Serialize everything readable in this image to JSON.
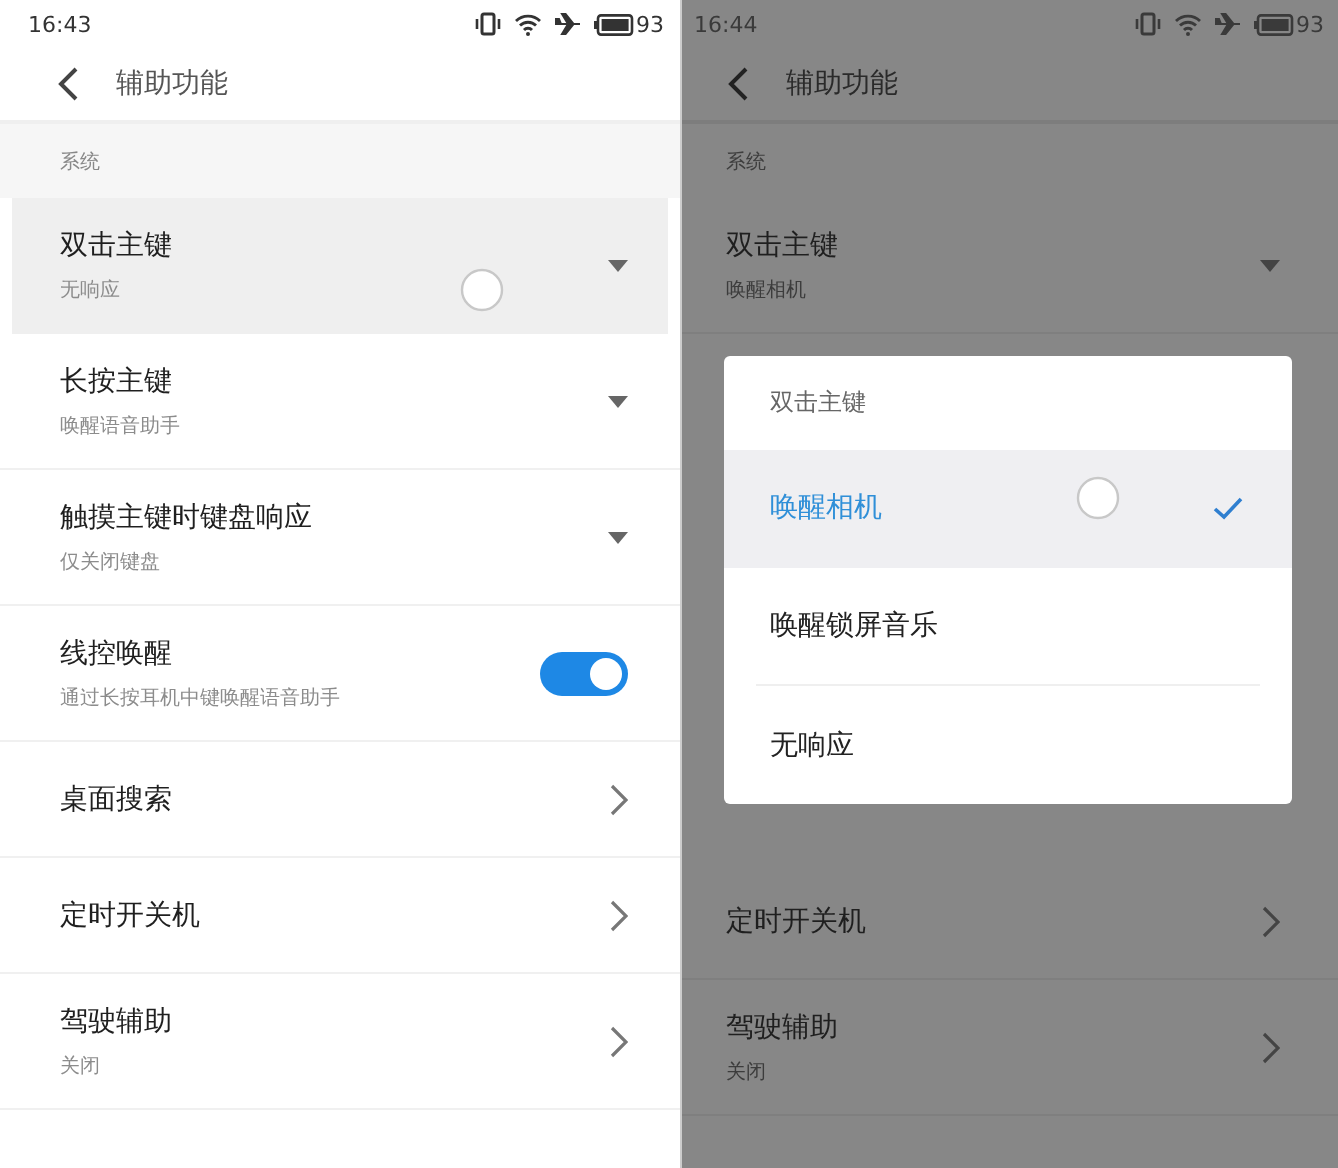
{
  "screens": [
    {
      "dimmed": false,
      "status_bar": {
        "time": "16:43",
        "battery": "93"
      },
      "header": {
        "title": "辅助功能"
      },
      "section": "系统",
      "rows": [
        {
          "kind": "dropdown",
          "title": "双击主键",
          "subtitle": "无响应",
          "pressed": true,
          "touched": true
        },
        {
          "kind": "dropdown",
          "title": "长按主键",
          "subtitle": "唤醒语音助手",
          "pressed": false,
          "touched": false
        },
        {
          "kind": "dropdown",
          "title": "触摸主键时键盘响应",
          "subtitle": "仅关闭键盘",
          "pressed": false,
          "touched": false
        },
        {
          "kind": "toggle",
          "title": "线控唤醒",
          "subtitle": "通过长按耳机中键唤醒语音助手",
          "on": true,
          "pressed": false,
          "touched": false
        },
        {
          "kind": "link",
          "title": "桌面搜索",
          "pressed": false,
          "touched": false
        },
        {
          "kind": "link",
          "title": "定时开关机",
          "pressed": false,
          "touched": false
        },
        {
          "kind": "link",
          "title": "驾驶辅助",
          "subtitle": "关闭",
          "pressed": false,
          "touched": false
        }
      ]
    },
    {
      "dimmed": true,
      "status_bar": {
        "time": "16:44",
        "battery": "93"
      },
      "header": {
        "title": "辅助功能"
      },
      "section": "系统",
      "rows": [
        {
          "kind": "dropdown",
          "title": "双击主键",
          "subtitle": "唤醒相机",
          "pressed": false,
          "touched": false
        }
      ],
      "dialog": {
        "title": "双击主键",
        "options": [
          {
            "label": "唤醒相机",
            "selected": true,
            "touched": true
          },
          {
            "label": "唤醒锁屏音乐",
            "selected": false,
            "touched": false
          },
          {
            "label": "无响应",
            "selected": false,
            "touched": false
          }
        ]
      },
      "rows_below": [
        {
          "kind": "link",
          "title": "定时开关机",
          "pressed": false,
          "touched": false
        },
        {
          "kind": "link",
          "title": "驾驶辅助",
          "subtitle": "关闭",
          "pressed": false,
          "touched": false
        }
      ]
    }
  ]
}
